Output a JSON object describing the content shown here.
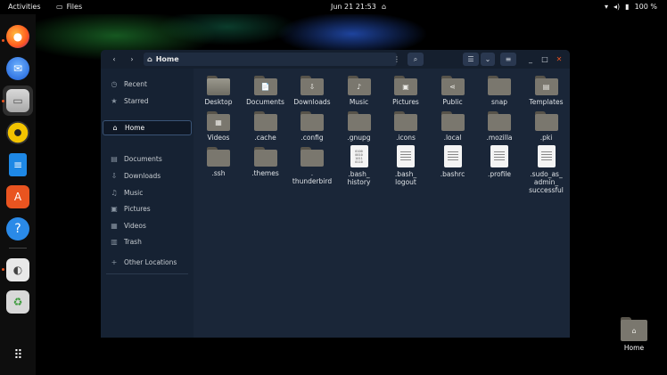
{
  "topbar": {
    "activities": "Activities",
    "app_name": "Files",
    "clock": "Jun 21  21:53",
    "battery": "100 %"
  },
  "dock": {
    "apps": [
      "firefox",
      "thunderbird",
      "files",
      "rhythmbox",
      "libreoffice-writer",
      "app-center",
      "help",
      "settings",
      "trash",
      "show-apps"
    ]
  },
  "window": {
    "path": "Home",
    "sidebar": [
      {
        "icon": "clock-icon",
        "label": "Recent"
      },
      {
        "icon": "star-icon",
        "label": "Starred"
      },
      {
        "icon": "home-icon",
        "label": "Home"
      },
      {
        "icon": "documents-icon",
        "label": "Documents"
      },
      {
        "icon": "downloads-icon",
        "label": "Downloads"
      },
      {
        "icon": "music-icon",
        "label": "Music"
      },
      {
        "icon": "pictures-icon",
        "label": "Pictures"
      },
      {
        "icon": "videos-icon",
        "label": "Videos"
      },
      {
        "icon": "trash-icon",
        "label": "Trash"
      },
      {
        "icon": "plus-icon",
        "label": "Other Locations"
      }
    ],
    "files": [
      {
        "name": "Desktop",
        "kind": "folder-desktop"
      },
      {
        "name": "Documents",
        "kind": "folder",
        "glyph": "📄"
      },
      {
        "name": "Downloads",
        "kind": "folder",
        "glyph": "⇩"
      },
      {
        "name": "Music",
        "kind": "folder",
        "glyph": "♪"
      },
      {
        "name": "Pictures",
        "kind": "folder",
        "glyph": "▣"
      },
      {
        "name": "Public",
        "kind": "folder",
        "glyph": "⋖"
      },
      {
        "name": "snap",
        "kind": "folder",
        "glyph": ""
      },
      {
        "name": "Templates",
        "kind": "folder",
        "glyph": "▤"
      },
      {
        "name": "Videos",
        "kind": "folder",
        "glyph": "▦"
      },
      {
        "name": ".cache",
        "kind": "folder",
        "glyph": ""
      },
      {
        "name": ".config",
        "kind": "folder",
        "glyph": ""
      },
      {
        "name": ".gnupg",
        "kind": "folder",
        "glyph": ""
      },
      {
        "name": ".icons",
        "kind": "folder",
        "glyph": ""
      },
      {
        "name": ".local",
        "kind": "folder",
        "glyph": ""
      },
      {
        "name": ".mozilla",
        "kind": "folder",
        "glyph": ""
      },
      {
        "name": ".pki",
        "kind": "folder",
        "glyph": ""
      },
      {
        "name": ".ssh",
        "kind": "folder",
        "glyph": ""
      },
      {
        "name": ".themes",
        "kind": "folder",
        "glyph": ""
      },
      {
        "name": ".\nthunderbird",
        "kind": "folder",
        "glyph": ""
      },
      {
        "name": ".bash_\nhistory",
        "kind": "binary",
        "bin": "0100\n0010\n1011\n0110"
      },
      {
        "name": ".bash_\nlogout",
        "kind": "text"
      },
      {
        "name": ".bashrc",
        "kind": "text"
      },
      {
        "name": ".profile",
        "kind": "text"
      },
      {
        "name": ".sudo_as_\nadmin_\nsuccessful",
        "kind": "text"
      }
    ]
  },
  "desktop": {
    "home_label": "Home"
  }
}
